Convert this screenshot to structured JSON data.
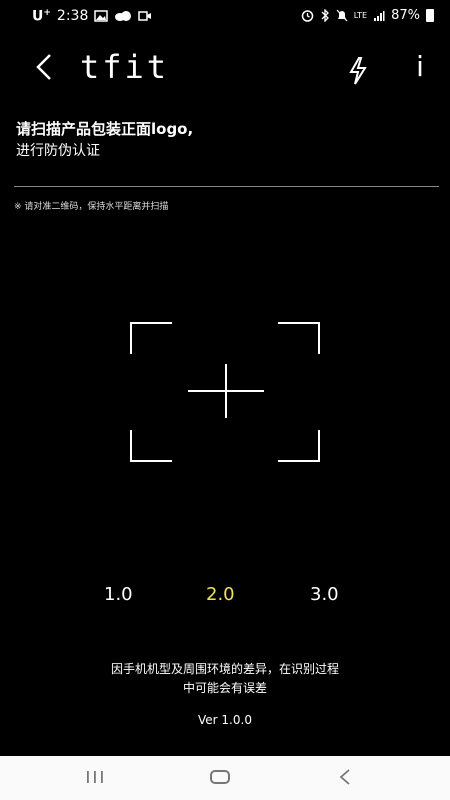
{
  "status": {
    "carrier": "U",
    "carrier_sup": "+",
    "time": "2:38",
    "battery": "87%",
    "network": "LTE"
  },
  "header": {
    "brand": "tfit",
    "back_icon": "chevron-left-icon",
    "flash_icon": "flash-icon",
    "info_label": "i"
  },
  "instructions": {
    "title_line1": "请扫描产品包装正面logo,",
    "title_line2": "进行防伪认证",
    "hint": "※ 请对准二维码，保持水平距离并扫描"
  },
  "zoom": {
    "options": [
      "1.0",
      "2.0",
      "3.0"
    ],
    "selected": "2.0",
    "selected_color": "#f1e05a"
  },
  "footer": {
    "note_line1": "因手机机型及周围环境的差异，在识别过程",
    "note_line2": "中可能会有误差",
    "version": "Ver 1.0.0"
  }
}
